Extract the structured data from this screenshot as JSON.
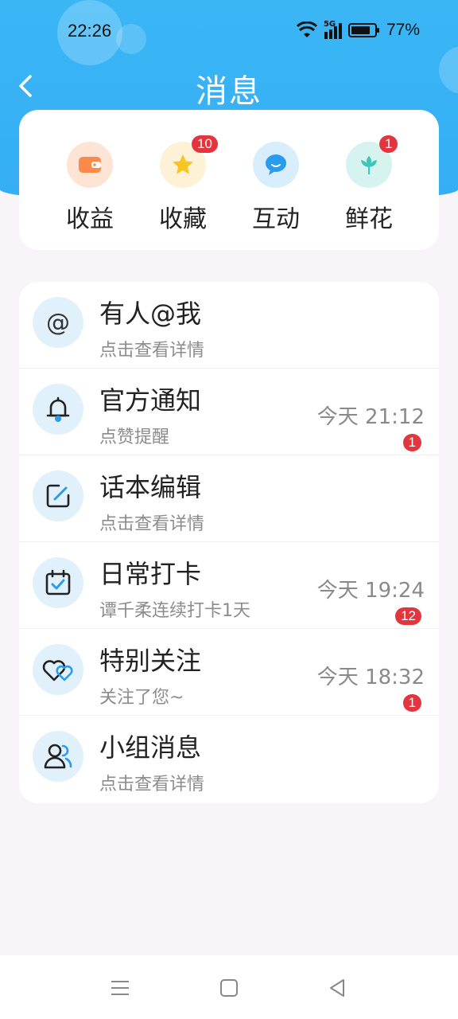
{
  "status_bar": {
    "time": "22:26",
    "network": "5G",
    "battery": "77%",
    "icons": [
      "wifi-icon",
      "cellular-signal-icon",
      "battery-icon"
    ]
  },
  "header": {
    "title": "消息",
    "back_icon": "chevron-left-icon",
    "accent_color": "#35aef5"
  },
  "quick_actions": [
    {
      "label": "收益",
      "icon": "wallet-icon",
      "badge": ""
    },
    {
      "label": "收藏",
      "icon": "star-icon",
      "badge": "10"
    },
    {
      "label": "互动",
      "icon": "chat-bubble-icon",
      "badge": ""
    },
    {
      "label": "鲜花",
      "icon": "flower-icon",
      "badge": "1"
    }
  ],
  "messages": [
    {
      "title": "有人@我",
      "subtitle": "点击查看详情",
      "time": "",
      "badge": "",
      "icon": "at-icon"
    },
    {
      "title": "官方通知",
      "subtitle": "点赞提醒",
      "time": "今天 21:12",
      "badge": "1",
      "icon": "bell-icon"
    },
    {
      "title": "话本编辑",
      "subtitle": "点击查看详情",
      "time": "",
      "badge": "",
      "icon": "edit-icon"
    },
    {
      "title": "日常打卡",
      "subtitle": "谭千柔连续打卡1天",
      "time": "今天 19:24",
      "badge": "12",
      "icon": "calendar-check-icon"
    },
    {
      "title": "特别关注",
      "subtitle": "关注了您~",
      "time": "今天 18:32",
      "badge": "1",
      "icon": "hearts-icon"
    },
    {
      "title": "小组消息",
      "subtitle": "点击查看详情",
      "time": "",
      "badge": "",
      "icon": "group-icon"
    }
  ],
  "colors": {
    "badge": "#e3353e",
    "icon_bg": "#e1f1fc",
    "page_bg": "#f7f5f7"
  },
  "system_nav": [
    "menu-icon",
    "home-icon",
    "back-triangle-icon"
  ]
}
